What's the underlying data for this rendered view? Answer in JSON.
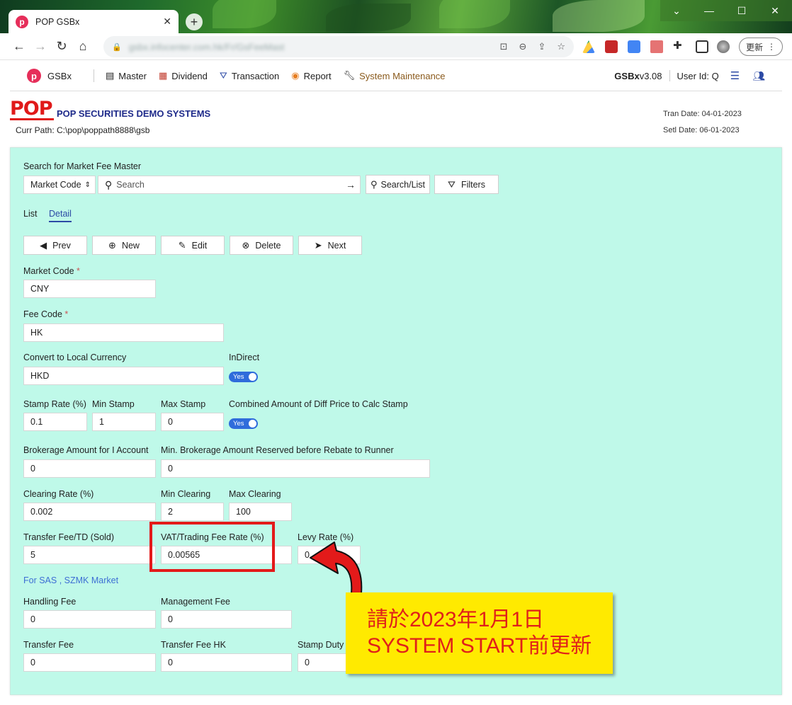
{
  "browser": {
    "tab_title": "POP GSBx",
    "tab_close": "✕",
    "new_tab": "+",
    "url": "gsbx.infocenter.com.hk/Fr/GsFeeMast",
    "update_label": "更新",
    "controls": {
      "chevron": "⌄",
      "minimize": "—",
      "maximize": "☐",
      "close": "✕"
    }
  },
  "appnav": {
    "brand": "GSBx",
    "menus": [
      {
        "label": "Master",
        "icon": "database-icon"
      },
      {
        "label": "Dividend",
        "icon": "coins-icon"
      },
      {
        "label": "Transaction",
        "icon": "transaction-icon"
      },
      {
        "label": "Report",
        "icon": "report-icon"
      },
      {
        "label": "System Maintenance",
        "icon": "wrench-icon"
      }
    ],
    "version_name": "GSBx",
    "version_num": " v3.08",
    "user": "User Id: Q"
  },
  "header": {
    "logo_text": "POP",
    "company": "POP SECURITIES DEMO SYSTEMS",
    "curr_path": "Curr Path: C:\\pop\\poppath8888\\gsb",
    "tran_date": "Tran Date: 04-01-2023",
    "setl_date": "Setl Date: 06-01-2023"
  },
  "search": {
    "title": "Search for Market Fee Master",
    "field_select": "Market Code",
    "placeholder": "Search",
    "search_list_label": "Search/List",
    "filters_label": "Filters"
  },
  "tabs": {
    "list": "List",
    "detail": "Detail"
  },
  "toolbar": {
    "prev": "Prev",
    "new": "New",
    "edit": "Edit",
    "delete": "Delete",
    "next": "Next"
  },
  "form": {
    "market_code": {
      "label": "Market Code",
      "value": "CNY"
    },
    "fee_code": {
      "label": "Fee Code",
      "value": "HK"
    },
    "required_mark": "*",
    "convert_currency": {
      "label": "Convert to Local Currency",
      "value": "HKD"
    },
    "indirect": {
      "label": "InDirect",
      "toggle": "Yes"
    },
    "stamp_rate": {
      "label": "Stamp Rate (%)",
      "value": "0.1"
    },
    "min_stamp": {
      "label": "Min Stamp",
      "value": "1"
    },
    "max_stamp": {
      "label": "Max Stamp",
      "value": "0"
    },
    "combined_amount": {
      "label": "Combined Amount of Diff Price to Calc Stamp",
      "toggle": "Yes"
    },
    "brokerage_amount": {
      "label": "Brokerage Amount for I Account",
      "value": "0"
    },
    "min_brokerage": {
      "label": "Min. Brokerage Amount Reserved before Rebate to Runner",
      "value": "0"
    },
    "clearing_rate": {
      "label": "Clearing Rate (%)",
      "value": "0.002"
    },
    "min_clearing": {
      "label": "Min Clearing",
      "value": "2"
    },
    "max_clearing": {
      "label": "Max Clearing",
      "value": "100"
    },
    "transfer_fee_td": {
      "label": "Transfer Fee/TD (Sold)",
      "value": "5"
    },
    "vat_rate": {
      "label": "VAT/Trading Fee Rate (%)",
      "value": "0.00565"
    },
    "levy_rate": {
      "label": "Levy Rate (%)",
      "value": "0"
    },
    "sas_link": "For SAS , SZMK Market",
    "handling_fee": {
      "label": "Handling Fee",
      "value": "0"
    },
    "management_fee": {
      "label": "Management Fee",
      "value": "0"
    },
    "transfer_fee": {
      "label": "Transfer Fee",
      "value": "0"
    },
    "transfer_fee_hk": {
      "label": "Transfer Fee HK",
      "value": "0"
    },
    "stamp_duty": {
      "label": "Stamp Duty",
      "value": "0"
    }
  },
  "annotation": {
    "line1": "請於2023年1月1日",
    "line2": "SYSTEM START前更新",
    "highlight_color": "#e31a1a",
    "callout_color": "#ffea00"
  }
}
